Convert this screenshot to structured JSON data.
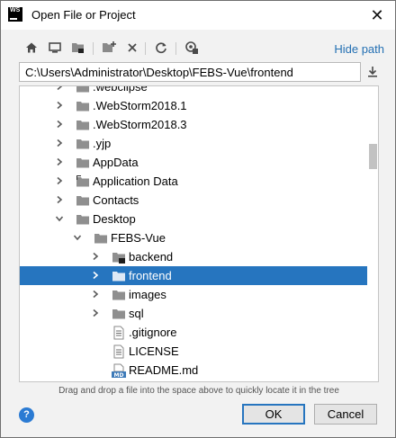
{
  "window": {
    "title": "Open File or Project",
    "logo_text": "WS"
  },
  "toolbar": {
    "hide_path_label": "Hide path",
    "buttons": [
      "home-icon",
      "desktop-icon",
      "project-folder-icon",
      "new-folder-icon",
      "delete-icon",
      "refresh-icon",
      "show-hidden-icon"
    ]
  },
  "path": {
    "value": "C:\\Users\\Administrator\\Desktop\\FEBS-Vue\\frontend"
  },
  "tree": {
    "rows": [
      {
        "label": ".webclipse",
        "expanded": false,
        "type": "folder",
        "indent": 0
      },
      {
        "label": ".WebStorm2018.1",
        "expanded": false,
        "type": "folder",
        "indent": 0
      },
      {
        "label": ".WebStorm2018.3",
        "expanded": false,
        "type": "folder",
        "indent": 0
      },
      {
        "label": ".yjp",
        "expanded": false,
        "type": "folder",
        "indent": 0
      },
      {
        "label": "AppData",
        "expanded": false,
        "type": "folder",
        "indent": 0
      },
      {
        "label": "Application Data",
        "expanded": false,
        "type": "folder-link",
        "indent": 0
      },
      {
        "label": "Contacts",
        "expanded": false,
        "type": "folder",
        "indent": 0
      },
      {
        "label": "Desktop",
        "expanded": true,
        "type": "folder",
        "indent": 0
      },
      {
        "label": "FEBS-Vue",
        "expanded": true,
        "type": "folder",
        "indent": 1
      },
      {
        "label": "backend",
        "expanded": false,
        "type": "project-folder",
        "indent": 2
      },
      {
        "label": "frontend",
        "expanded": false,
        "type": "folder",
        "indent": 2,
        "selected": true
      },
      {
        "label": "images",
        "expanded": false,
        "type": "folder",
        "indent": 2
      },
      {
        "label": "sql",
        "expanded": false,
        "type": "folder",
        "indent": 2
      },
      {
        "label": ".gitignore",
        "type": "file",
        "indent": 2
      },
      {
        "label": "LICENSE",
        "type": "file",
        "indent": 2
      },
      {
        "label": "README.md",
        "type": "md-file",
        "indent": 2
      }
    ]
  },
  "hint": "Drag and drop a file into the space above to quickly locate it in the tree",
  "buttons": {
    "ok": "OK",
    "cancel": "Cancel",
    "help": "?"
  },
  "colors": {
    "selection": "#2675bf",
    "link": "#2470b3",
    "help": "#2b7bd3"
  }
}
